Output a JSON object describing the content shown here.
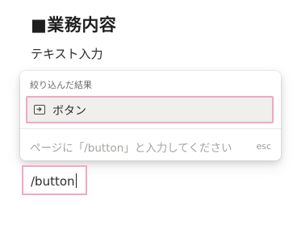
{
  "content": {
    "heading": "■業務内容",
    "body_text": "テキスト入力"
  },
  "slash_menu": {
    "section_label": "絞り込んだ結果",
    "results": [
      {
        "label": "ボタン",
        "icon": "button-block-icon"
      }
    ],
    "hint": "ページに「/button」と入力してください",
    "esc_label": "esc"
  },
  "editor_input": {
    "value": "/button"
  },
  "colors": {
    "highlight_border": "#f1a7c3",
    "selected_bg": "#efefed"
  }
}
